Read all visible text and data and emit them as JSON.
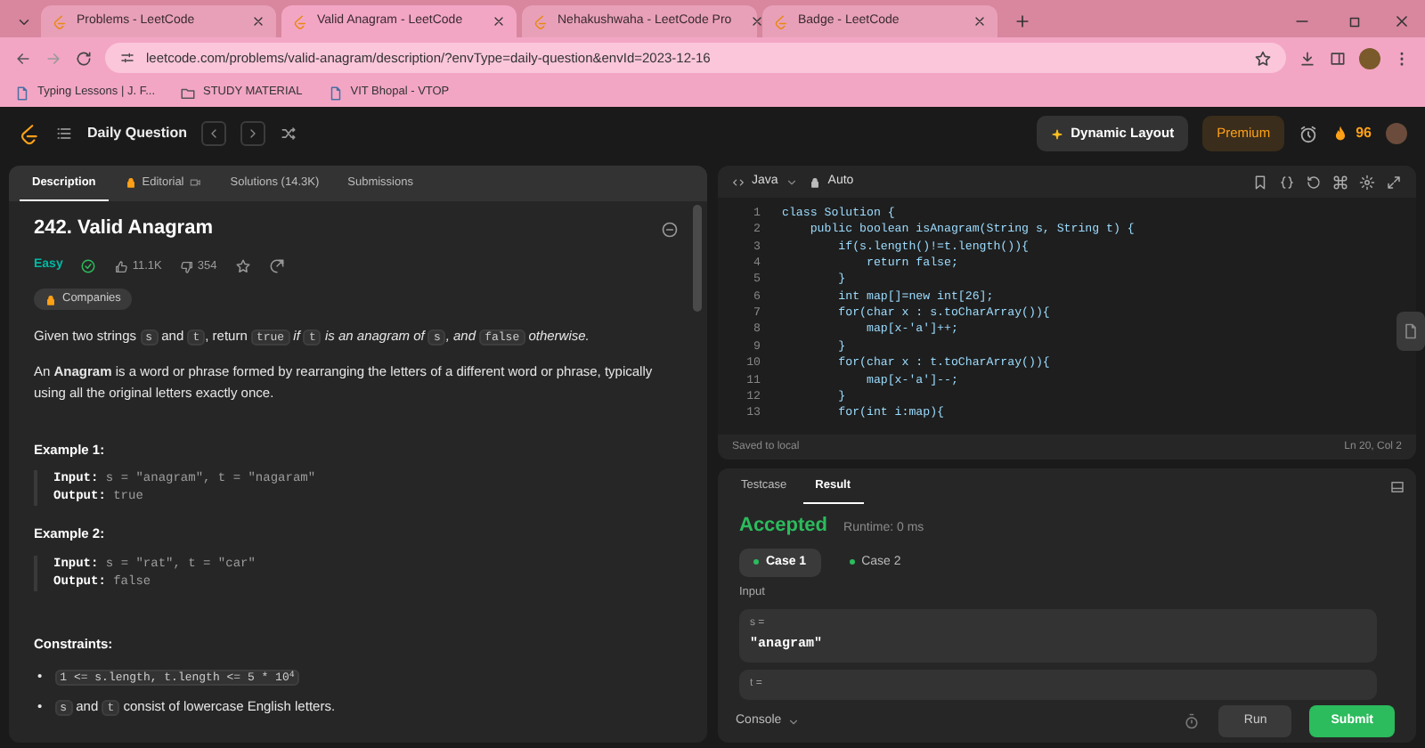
{
  "browser": {
    "tabs": [
      {
        "title": "Problems - LeetCode",
        "selected": false
      },
      {
        "title": "Valid Anagram - LeetCode",
        "selected": true
      },
      {
        "title": "Nehakushwaha - LeetCode Pro",
        "selected": false
      },
      {
        "title": "Badge - LeetCode",
        "selected": false
      }
    ],
    "url": "leetcode.com/problems/valid-anagram/description/?envType=daily-question&envId=2023-12-16",
    "bookmarks": [
      {
        "kind": "site",
        "title": "Typing Lessons | J. F..."
      },
      {
        "kind": "folder",
        "title": "STUDY MATERIAL"
      },
      {
        "kind": "site",
        "title": "VIT Bhopal - VTOP"
      }
    ]
  },
  "nav": {
    "title": "Daily Question",
    "layout_button": "Dynamic Layout",
    "premium_button": "Premium",
    "streak": "96"
  },
  "description_panel": {
    "tabs": [
      {
        "label": "Description",
        "selected": true,
        "locked": false,
        "video": false
      },
      {
        "label": "Editorial",
        "selected": false,
        "locked": true,
        "video": true
      },
      {
        "label": "Solutions (14.3K)",
        "selected": false,
        "locked": false,
        "video": false
      },
      {
        "label": "Submissions",
        "selected": false,
        "locked": false,
        "video": false
      }
    ],
    "title": "242. Valid Anagram",
    "difficulty": "Easy",
    "solved": true,
    "likes": "11.1K",
    "dislikes": "354",
    "companies": "Companies",
    "paragraphs": [
      [
        {
          "kind": "text",
          "text": "Given two strings "
        },
        {
          "kind": "code",
          "text": "s"
        },
        {
          "kind": "text",
          "text": " and "
        },
        {
          "kind": "code",
          "text": "t"
        },
        {
          "kind": "text",
          "text": ", return "
        },
        {
          "kind": "code",
          "text": "true"
        },
        {
          "kind": "italic",
          "text": " if "
        },
        {
          "kind": "code",
          "text": "t"
        },
        {
          "kind": "italic",
          "text": " is an anagram of "
        },
        {
          "kind": "code",
          "text": "s"
        },
        {
          "kind": "italic",
          "text": ", and "
        },
        {
          "kind": "code",
          "text": "false"
        },
        {
          "kind": "italic",
          "text": " otherwise."
        }
      ],
      [
        {
          "kind": "text",
          "text": "An **Anagram** is a word or phrase formed by rearranging the letters of a different word or phrase, typically using all the original letters exactly once."
        }
      ]
    ],
    "examples": [
      {
        "title": "Example 1:",
        "input_label": "Input:",
        "input": "s = \"anagram\", t = \"nagaram\"",
        "output_label": "Output:",
        "output": "true"
      },
      {
        "title": "Example 2:",
        "input_label": "Input:",
        "input": "s = \"rat\", t = \"car\"",
        "output_label": "Output:",
        "output": "false"
      }
    ],
    "constraints_title": "Constraints:",
    "constraints": [
      {
        "marker": "•",
        "segments": [
          {
            "kind": "code",
            "text": "1 <= s.length, t.length <= 5 * 10$^{4}$"
          }
        ]
      },
      {
        "marker": "•",
        "segments": [
          {
            "kind": "code",
            "text": "s"
          },
          {
            "kind": "text",
            "text": " and "
          },
          {
            "kind": "code",
            "text": "t"
          },
          {
            "kind": "text",
            "text": " consist of lowercase English letters."
          }
        ]
      }
    ]
  },
  "editor": {
    "language": "Java",
    "mode": "Auto",
    "lines": [
      {
        "number": "1",
        "code": "class Solution {"
      },
      {
        "number": "2",
        "code": "    public boolean isAnagram(String s, String t) {"
      },
      {
        "number": "3",
        "code": "        if(s.length()!=t.length()){"
      },
      {
        "number": "4",
        "code": "            return false;"
      },
      {
        "number": "5",
        "code": "        }"
      },
      {
        "number": "6",
        "code": "        int map[]=new int[26];"
      },
      {
        "number": "7",
        "code": "        for(char x : s.toCharArray()){"
      },
      {
        "number": "8",
        "code": "            map[x-'a']++;"
      },
      {
        "number": "9",
        "code": "        }"
      },
      {
        "number": "10",
        "code": "        for(char x : t.toCharArray()){"
      },
      {
        "number": "11",
        "code": "            map[x-'a']--;"
      },
      {
        "number": "12",
        "code": "        }"
      },
      {
        "number": "13",
        "code": "        for(int i:map){"
      }
    ],
    "status": "Saved to local",
    "cursor": "Ln 20, Col 2"
  },
  "console": {
    "tabs": [
      {
        "label": "Testcase",
        "selected": false
      },
      {
        "label": "Result",
        "selected": true
      }
    ],
    "verdict": "Accepted",
    "runtime": "Runtime: 0 ms",
    "cases": [
      {
        "label": "Case 1",
        "selected": true,
        "passed": true
      },
      {
        "label": "Case 2",
        "selected": false,
        "passed": true
      }
    ],
    "input_title": "Input",
    "inputs": [
      {
        "label": "s =",
        "value": "\"anagram\""
      },
      {
        "label": "t ="
      }
    ],
    "console_button": "Console",
    "run_button": "Run",
    "submit_button": "Submit"
  }
}
